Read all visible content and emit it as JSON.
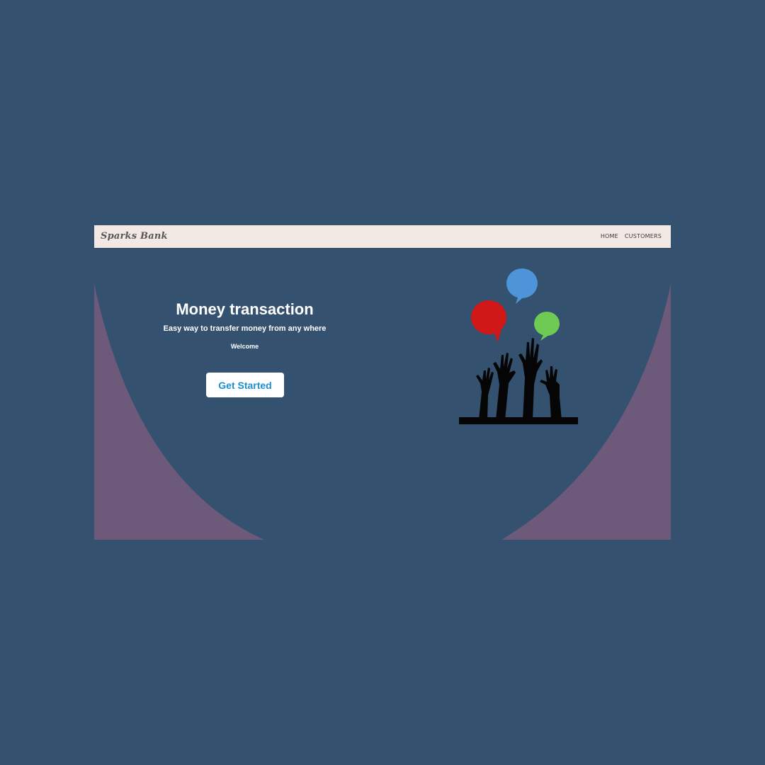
{
  "navbar": {
    "brand": "Sparks Bank",
    "links": [
      "HOME",
      "CUSTOMERS"
    ]
  },
  "hero": {
    "title": "Money transaction",
    "subtitle": "Easy way to transfer money from any where",
    "welcome": "Welcome",
    "cta_label": "Get Started"
  },
  "illustration": {
    "icon": "raised-hands-speech-bubbles",
    "bubble_colors": [
      "#4d95d8",
      "#d01818",
      "#6fca53"
    ]
  },
  "colors": {
    "page_background": "#345170",
    "curve_fill": "#6d5a7b",
    "navbar_background": "#f2e8e4",
    "button_text": "#1a8fd1"
  }
}
